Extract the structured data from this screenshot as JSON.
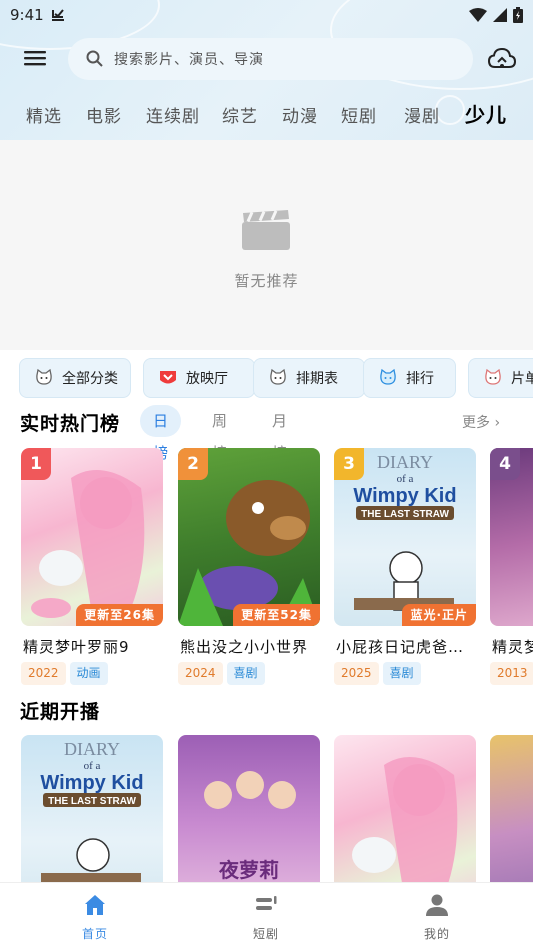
{
  "status_bar": {
    "time": "9:41"
  },
  "search": {
    "placeholder": "搜索影片、演员、导演"
  },
  "tabs": [
    {
      "label": "精选"
    },
    {
      "label": "电影"
    },
    {
      "label": "连续剧"
    },
    {
      "label": "综艺"
    },
    {
      "label": "动漫"
    },
    {
      "label": "短剧"
    },
    {
      "label": "漫剧"
    },
    {
      "label": "少儿"
    }
  ],
  "active_tab_index": 7,
  "empty": {
    "text": "暂无推荐",
    "icon": "clapperboard-icon"
  },
  "quick_links": [
    {
      "label": "全部分类",
      "icon": "cat-face-icon"
    },
    {
      "label": "放映厅",
      "icon": "red-shield-icon"
    },
    {
      "label": "排期表",
      "icon": "cat-face-icon"
    },
    {
      "label": "排行",
      "icon": "cat-face-blue-icon"
    },
    {
      "label": "片单",
      "icon": "cat-face-icon"
    }
  ],
  "hot_section": {
    "title": "实时热门榜",
    "tabs": [
      {
        "label": "日榜"
      },
      {
        "label": "周榜"
      },
      {
        "label": "月榜"
      }
    ],
    "more": "更多",
    "items": [
      {
        "rank": "1",
        "title": "精灵梦叶罗丽9",
        "badge": "更新至26集",
        "year": "2022",
        "genre": "动画"
      },
      {
        "rank": "2",
        "title": "熊出没之小小世界",
        "badge": "更新至52集",
        "year": "2024",
        "genre": "喜剧"
      },
      {
        "rank": "3",
        "title": "小屁孩日记虎爸的最后一根稻草",
        "badge": "蓝光·正片",
        "year": "2025",
        "genre": "喜剧"
      },
      {
        "rank": "4",
        "title": "精灵梦",
        "badge": "",
        "year": "2013",
        "genre": ""
      }
    ]
  },
  "upcoming_section": {
    "title": "近期开播"
  },
  "posters": {
    "wimpy_title_line1": "DIARY",
    "wimpy_title_line2": "of a",
    "wimpy_title_line3": "Wimpy Kid",
    "wimpy_title_line4": "THE LAST STRAW",
    "yeluoli_title": "夜萝莉"
  },
  "bottom_nav": [
    {
      "label": "首页"
    },
    {
      "label": "短剧"
    },
    {
      "label": "我的"
    }
  ],
  "colors": {
    "accent": "#3b8be3",
    "rank1": "#f0585a",
    "rank2": "#f0913a",
    "rank3": "#f2b62c",
    "rank4": "#7a4e8c"
  }
}
